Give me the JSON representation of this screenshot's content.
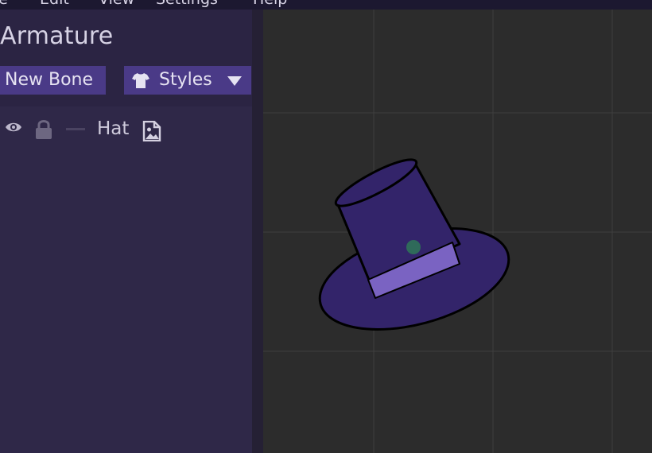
{
  "menu": {
    "items": [
      {
        "label": "File"
      },
      {
        "label": "Edit"
      },
      {
        "label": "View"
      },
      {
        "label": "Settings"
      },
      {
        "label": "Help"
      }
    ]
  },
  "panel": {
    "title": "Armature",
    "new_bone_label": "New Bone",
    "styles_label": "Styles",
    "styles_icon": "shirt-icon",
    "bones": [
      {
        "name": "Hat",
        "visible_icon": "eye-icon",
        "lock_icon": "lock-icon",
        "image_icon": "image-file-icon"
      }
    ]
  },
  "viewport": {
    "grid": true,
    "object": "top-hat",
    "colors": {
      "hat_fill": "#33246a",
      "band_fill": "#7a63c2",
      "outline": "#000000",
      "pivot": "#2f6a5a",
      "grid_line": "#3e3e3e",
      "background": "#2c2c2c"
    }
  },
  "theme": {
    "panel_bg": "#2b2443",
    "button_bg": "#4a3a87",
    "text": "#d6d2e4"
  }
}
